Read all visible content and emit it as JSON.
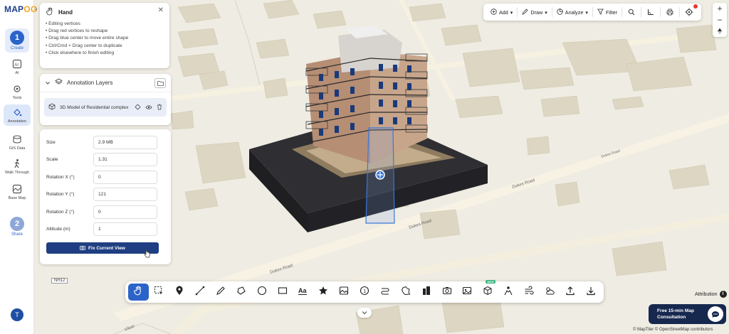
{
  "logo": {
    "text_a": "MAP",
    "text_b": "OG"
  },
  "rail": {
    "create_step": {
      "number": "1",
      "label": "Create"
    },
    "items": [
      {
        "label": "AI"
      },
      {
        "label": "Tools"
      },
      {
        "label": "Annotation"
      },
      {
        "label": "GIS Data"
      },
      {
        "label": "Walk Through"
      },
      {
        "label": "Base Map"
      }
    ],
    "share_step": {
      "number": "2",
      "label": "Share"
    },
    "avatar": "T"
  },
  "hand_card": {
    "title": "Hand",
    "tips": [
      "• Editing vertices",
      "• Drag red vertices to reshape",
      "• Drag blue center to move entire shape",
      "• Ctrl/Cmd + Drag center to duplicate",
      "• Click elsewhere to finish editing"
    ]
  },
  "layers": {
    "title": "Annotation Layers",
    "item_name": "3D Model of Residential complex"
  },
  "properties": {
    "rows": [
      {
        "label": "Size",
        "value": "2.9 MB"
      },
      {
        "label": "Scale",
        "value": "1.31"
      },
      {
        "label": "Rotation X (°)",
        "value": "0"
      },
      {
        "label": "Rotation Y (°)",
        "value": "121"
      },
      {
        "label": "Rotation Z (°)",
        "value": "0"
      },
      {
        "label": "Altitude (m)",
        "value": "1"
      }
    ],
    "fix_button": "Fix Current View"
  },
  "topbar": {
    "add": "Add",
    "draw": "Draw",
    "analyze": "Analyze",
    "filter": "Filter"
  },
  "map": {
    "road_labels": [
      "Dukes Road",
      "Dukes Road",
      "Dukes Road",
      "Dukes Road"
    ],
    "nh_label": "NH12",
    "vikas_label": "Vikas"
  },
  "attribution": {
    "label": "Attribution"
  },
  "consult": {
    "line1": "Free 15-min Map",
    "line2": "Consultation"
  },
  "credits": "© MapTiler © OpenStreetMap contributors",
  "new_badge": "NEW"
}
